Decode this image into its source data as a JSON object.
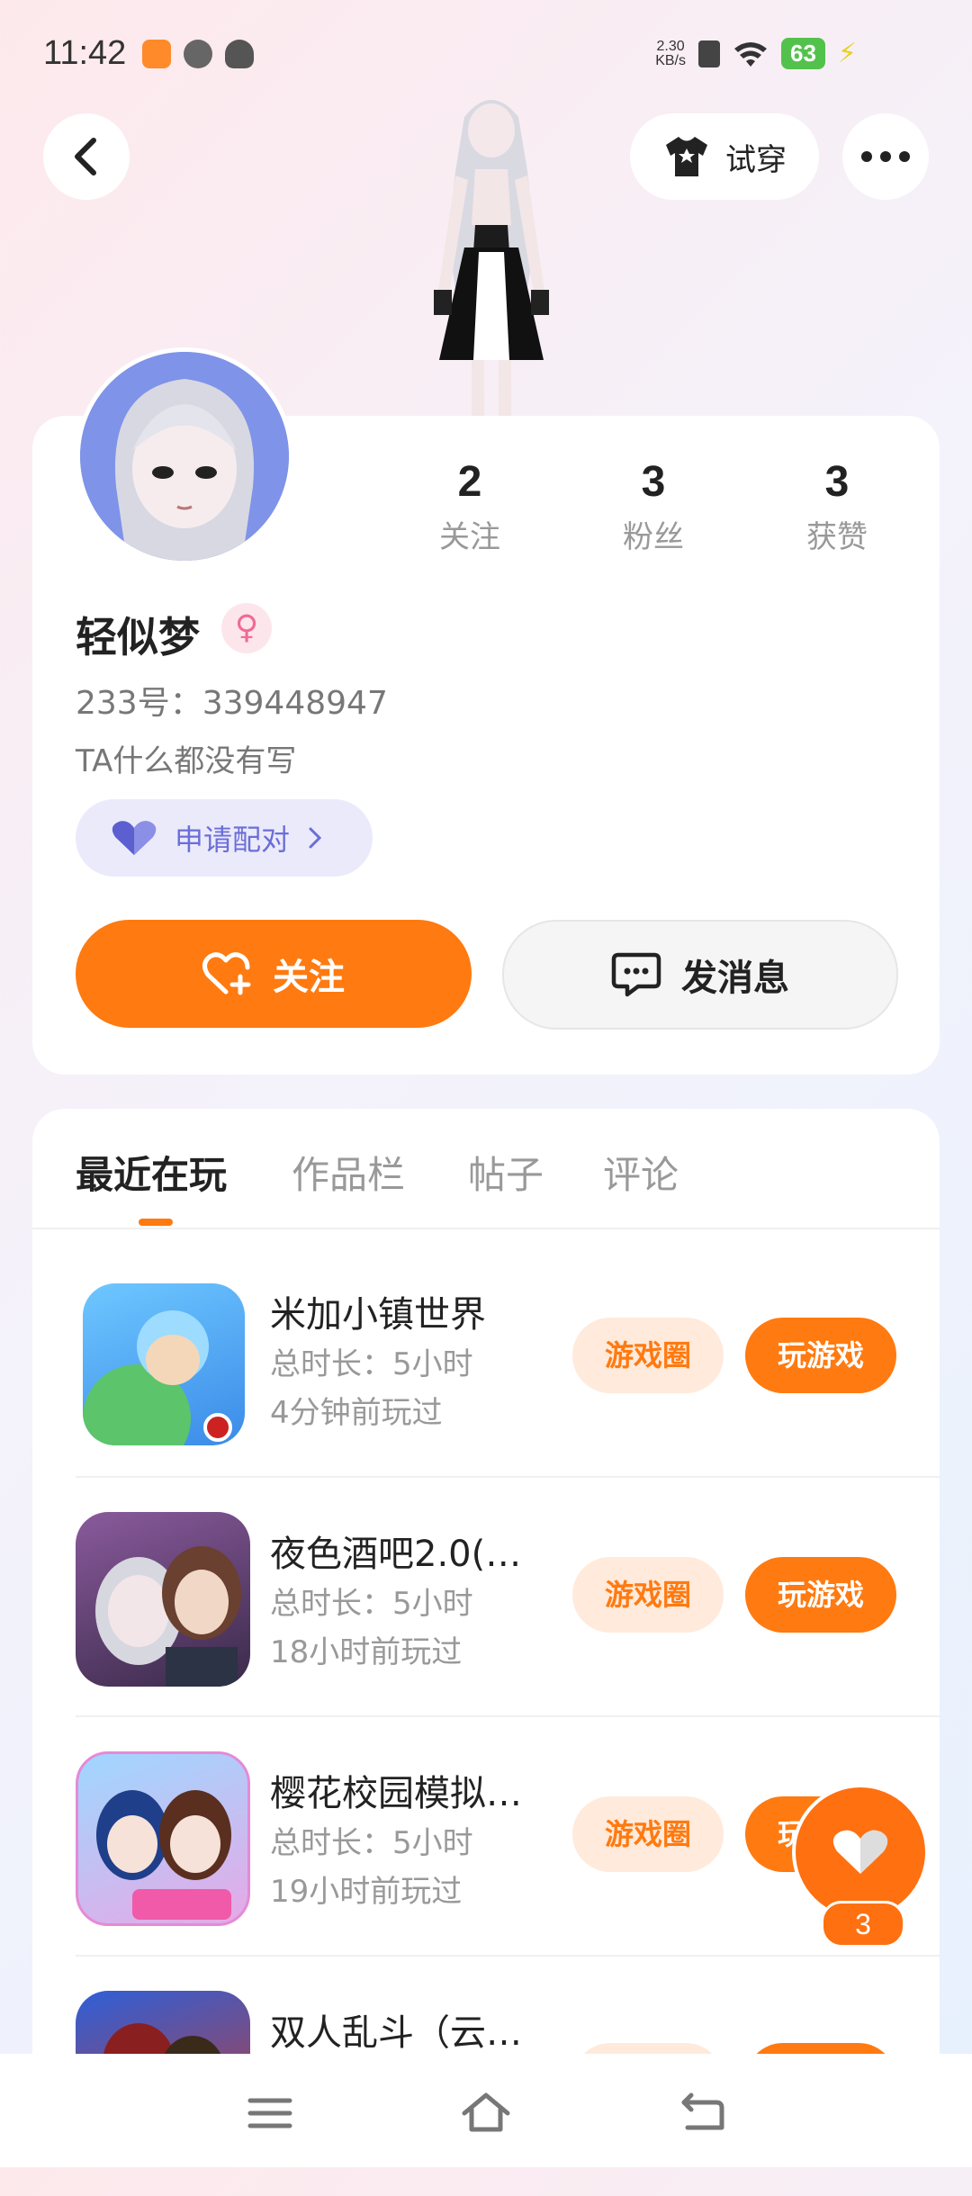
{
  "status_bar": {
    "time": "11:42",
    "net_speed_value": "2.30",
    "net_speed_unit": "KB/s",
    "battery": "63"
  },
  "header": {
    "back_icon": "chevron-left-icon",
    "try_on_label": "试穿",
    "more_icon": "more-dots-icon"
  },
  "profile": {
    "name": "轻似梦",
    "gender": "female",
    "gender_symbol": "♀",
    "id_line": "233号：339448947",
    "bio": "TA什么都没有写",
    "pair_label": "申请配对",
    "stats": [
      {
        "value": "2",
        "label": "关注"
      },
      {
        "value": "3",
        "label": "粉丝"
      },
      {
        "value": "3",
        "label": "获赞"
      }
    ],
    "follow_label": "关注",
    "message_label": "发消息"
  },
  "tabs": [
    "最近在玩",
    "作品栏",
    "帖子",
    "评论"
  ],
  "active_tab": "最近在玩",
  "games": [
    {
      "name": "米加小镇世界",
      "duration": "总时长：5小时",
      "last_played": "4分钟前玩过",
      "circle_label": "游戏圈",
      "play_label": "玩游戏"
    },
    {
      "name": "夜色酒吧2.0(…",
      "duration": "总时长：5小时",
      "last_played": "18小时前玩过",
      "circle_label": "游戏圈",
      "play_label": "玩游戏"
    },
    {
      "name": "樱花校园模拟…",
      "duration": "总时长：5小时",
      "last_played": "19小时前玩过",
      "circle_label": "游戏圈",
      "play_label": "玩游戏"
    },
    {
      "name": "双人乱斗（云…",
      "duration": "",
      "last_played": "",
      "circle_label": "",
      "play_label": ""
    }
  ],
  "fab": {
    "icon": "heart-icon",
    "count": "3"
  },
  "colors": {
    "accent": "#ff7a10",
    "pair": "#6b6ed8"
  }
}
